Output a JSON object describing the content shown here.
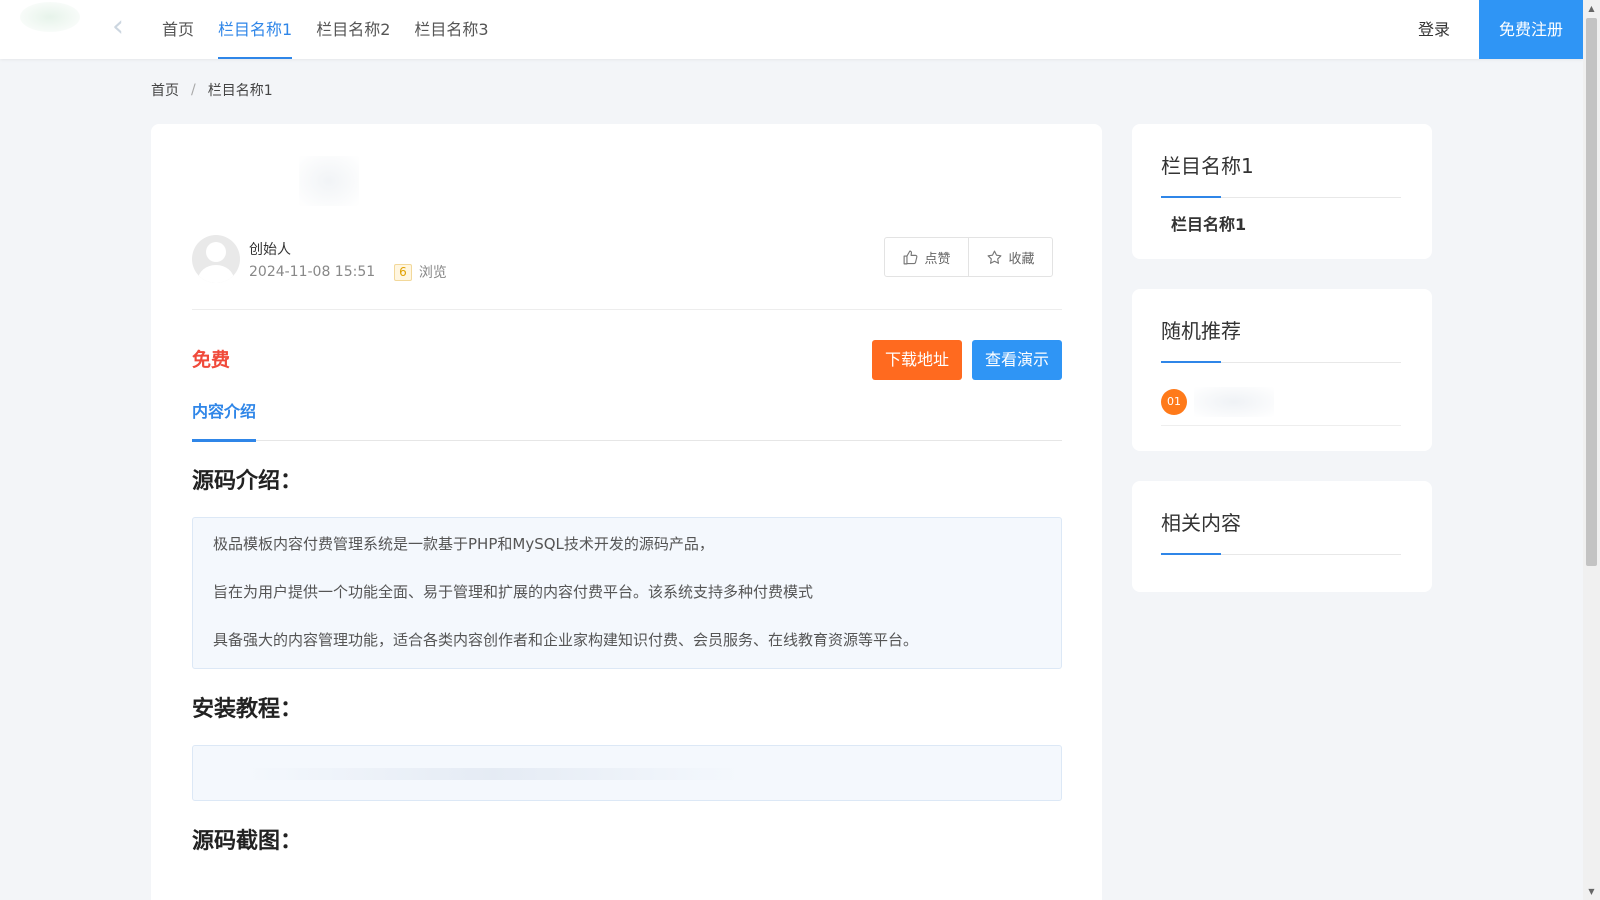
{
  "header": {
    "nav": [
      "首页",
      "栏目名称1",
      "栏目名称2",
      "栏目名称3"
    ],
    "active_index": 1,
    "login_label": "登录",
    "register_label": "免费注册"
  },
  "breadcrumb": {
    "home": "首页",
    "separator": "/",
    "current": "栏目名称1"
  },
  "article": {
    "author": "创始人",
    "date": "2024-11-08 15:51",
    "views": "6",
    "views_label": "浏览",
    "like_label": "点赞",
    "collect_label": "收藏",
    "price": "免费",
    "download_label": "下载地址",
    "demo_label": "查看演示",
    "tab_label": "内容介绍",
    "section1_title": "源码介绍：",
    "intro_lines": [
      "极品模板内容付费管理系统是一款基于PHP和MySQL技术开发的源码产品，",
      "旨在为用户提供一个功能全面、易于管理和扩展的内容付费平台。该系统支持多种付费模式",
      "具备强大的内容管理功能，适合各类内容创作者和企业家构建知识付费、会员服务、在线教育资源等平台。"
    ],
    "section2_title": "安装教程：",
    "section3_title": "源码截图："
  },
  "sidebar": {
    "category_card": {
      "title": "栏目名称1",
      "items": [
        "栏目名称1"
      ]
    },
    "random_card": {
      "title": "随机推荐",
      "rank": "01"
    },
    "related_card": {
      "title": "相关内容"
    }
  },
  "colors": {
    "accent": "#2f86e8",
    "register_bg": "#2f95f5",
    "download_bg": "#ff6a1f",
    "price": "#f04a3a",
    "rank_badge": "#ff7a1a"
  },
  "icons": [
    "thumbs-up-icon",
    "star-icon",
    "avatar-placeholder-icon",
    "chevron-left-icon"
  ]
}
